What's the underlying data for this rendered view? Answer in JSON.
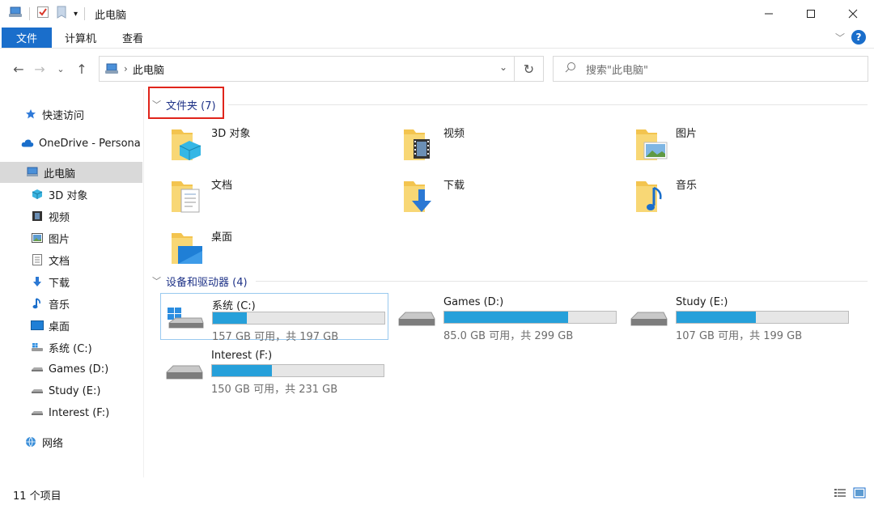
{
  "window": {
    "title": "此电脑"
  },
  "ribbon": {
    "tabs": [
      "文件",
      "计算机",
      "查看"
    ]
  },
  "address": {
    "crumb": "此电脑",
    "search_placeholder": "搜索\"此电脑\""
  },
  "sidebar": {
    "items": [
      {
        "label": "快速访问",
        "icon": "star-icon"
      },
      {
        "label": "OneDrive - Persona",
        "icon": "cloud-icon"
      },
      {
        "label": "此电脑",
        "icon": "computer-icon"
      },
      {
        "label": "3D 对象",
        "icon": "cube-icon"
      },
      {
        "label": "视频",
        "icon": "film-icon"
      },
      {
        "label": "图片",
        "icon": "picture-icon"
      },
      {
        "label": "文档",
        "icon": "document-icon"
      },
      {
        "label": "下载",
        "icon": "download-icon"
      },
      {
        "label": "音乐",
        "icon": "music-icon"
      },
      {
        "label": "桌面",
        "icon": "desktop-icon"
      },
      {
        "label": "系统 (C:)",
        "icon": "system-drive-icon"
      },
      {
        "label": "Games (D:)",
        "icon": "drive-icon"
      },
      {
        "label": "Study (E:)",
        "icon": "drive-icon"
      },
      {
        "label": "Interest (F:)",
        "icon": "drive-icon"
      },
      {
        "label": "网络",
        "icon": "network-icon"
      }
    ]
  },
  "folders_group": {
    "header": "文件夹 (7)",
    "items": [
      "3D 对象",
      "视频",
      "图片",
      "文档",
      "下载",
      "音乐",
      "桌面"
    ]
  },
  "drives_group": {
    "header": "设备和驱动器 (4)",
    "items": [
      {
        "name": "系统 (C:)",
        "size": "157 GB 可用，共 197 GB",
        "used_fraction": 0.2
      },
      {
        "name": "Games (D:)",
        "size": "85.0 GB 可用，共 299 GB",
        "used_fraction": 0.72
      },
      {
        "name": "Study (E:)",
        "size": "107 GB 可用，共 199 GB",
        "used_fraction": 0.46
      },
      {
        "name": "Interest (F:)",
        "size": "150 GB 可用，共 231 GB",
        "used_fraction": 0.35
      }
    ]
  },
  "status": {
    "count": "11 个项目"
  },
  "colors": {
    "accent": "#1a6ecb",
    "drive_fill": "#26a0da",
    "group_header": "#1e3287",
    "highlight_box": "#e0241b"
  }
}
